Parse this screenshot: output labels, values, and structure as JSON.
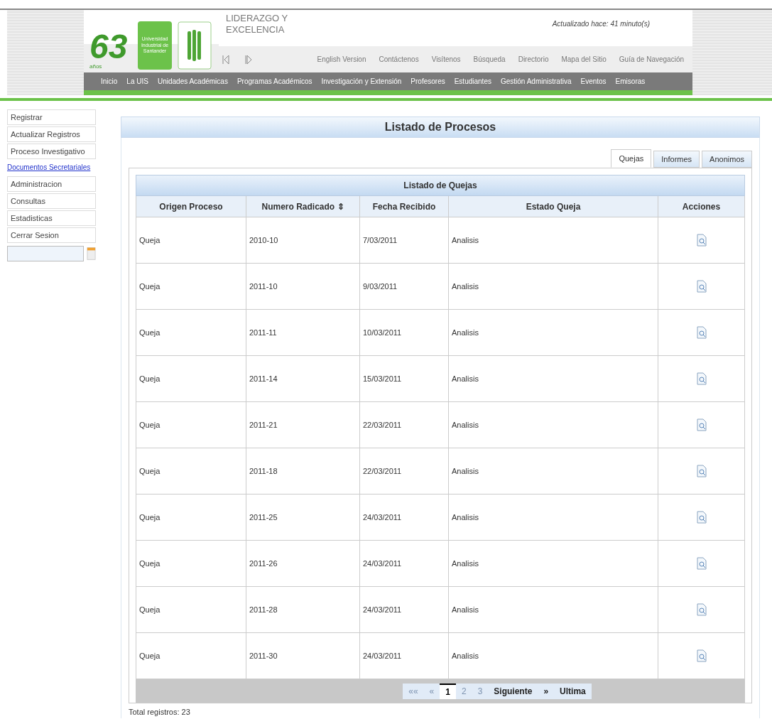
{
  "header": {
    "logo_number": "63",
    "logo_caption": "años",
    "university": "Universidad Industrial de Santander",
    "slogan": "LIDERAZGO Y EXCELENCIA",
    "updated": "Actualizado hace: 41 minuto(s)",
    "top_links": [
      "English Version",
      "Contáctenos",
      "Visítenos",
      "Búsqueda",
      "Directorio",
      "Mapa del Sitio",
      "Guía de Navegación"
    ],
    "nav": [
      "Inicio",
      "La UIS",
      "Unidades Académicas",
      "Programas Académicos",
      "Investigación y Extensión",
      "Profesores",
      "Estudiantes",
      "Gestión Administrativa",
      "Eventos",
      "Emisoras"
    ]
  },
  "sidebar": {
    "items": [
      {
        "label": "Registrar",
        "kind": "button"
      },
      {
        "label": "Actualizar Registros",
        "kind": "button"
      },
      {
        "label": "Proceso Investigativo",
        "kind": "button"
      },
      {
        "label": "Documentos Secretariales",
        "kind": "link"
      },
      {
        "label": "Administracion",
        "kind": "button"
      },
      {
        "label": "Consultas",
        "kind": "button"
      },
      {
        "label": "Estadisticas",
        "kind": "button"
      },
      {
        "label": "Cerrar Sesion",
        "kind": "button"
      }
    ]
  },
  "panel": {
    "title": "Listado de Procesos",
    "tabs": [
      {
        "label": "Quejas",
        "selected": true
      },
      {
        "label": "Informes",
        "selected": false
      },
      {
        "label": "Anonimos",
        "selected": false
      }
    ],
    "table": {
      "caption": "Listado de Quejas",
      "columns": [
        "Origen Proceso",
        "Numero Radicado ⇕",
        "Fecha Recibido",
        "Estado Queja",
        "Acciones"
      ],
      "rows": [
        [
          "Queja",
          "2010-10",
          "7/03/2011",
          "Analisis"
        ],
        [
          "Queja",
          "2011-10",
          "9/03/2011",
          "Analisis"
        ],
        [
          "Queja",
          "2011-11",
          "10/03/2011",
          "Analisis"
        ],
        [
          "Queja",
          "2011-14",
          "15/03/2011",
          "Analisis"
        ],
        [
          "Queja",
          "2011-21",
          "22/03/2011",
          "Analisis"
        ],
        [
          "Queja",
          "2011-18",
          "22/03/2011",
          "Analisis"
        ],
        [
          "Queja",
          "2011-25",
          "24/03/2011",
          "Analisis"
        ],
        [
          "Queja",
          "2011-26",
          "24/03/2011",
          "Analisis"
        ],
        [
          "Queja",
          "2011-28",
          "24/03/2011",
          "Analisis"
        ],
        [
          "Queja",
          "2011-30",
          "24/03/2011",
          "Analisis"
        ]
      ]
    },
    "pager": [
      {
        "label": "««",
        "selected": false,
        "disabled": true
      },
      {
        "label": "«",
        "selected": false,
        "disabled": true
      },
      {
        "label": "1",
        "selected": true,
        "disabled": false
      },
      {
        "label": "2",
        "selected": false,
        "disabled": true
      },
      {
        "label": "3",
        "selected": false,
        "disabled": true
      },
      {
        "label": "Siguiente",
        "selected": false,
        "disabled": false
      },
      {
        "label": "»",
        "selected": false,
        "disabled": false
      },
      {
        "label": "Ultima",
        "selected": false,
        "disabled": false
      }
    ],
    "total": "Total registros: 23"
  }
}
